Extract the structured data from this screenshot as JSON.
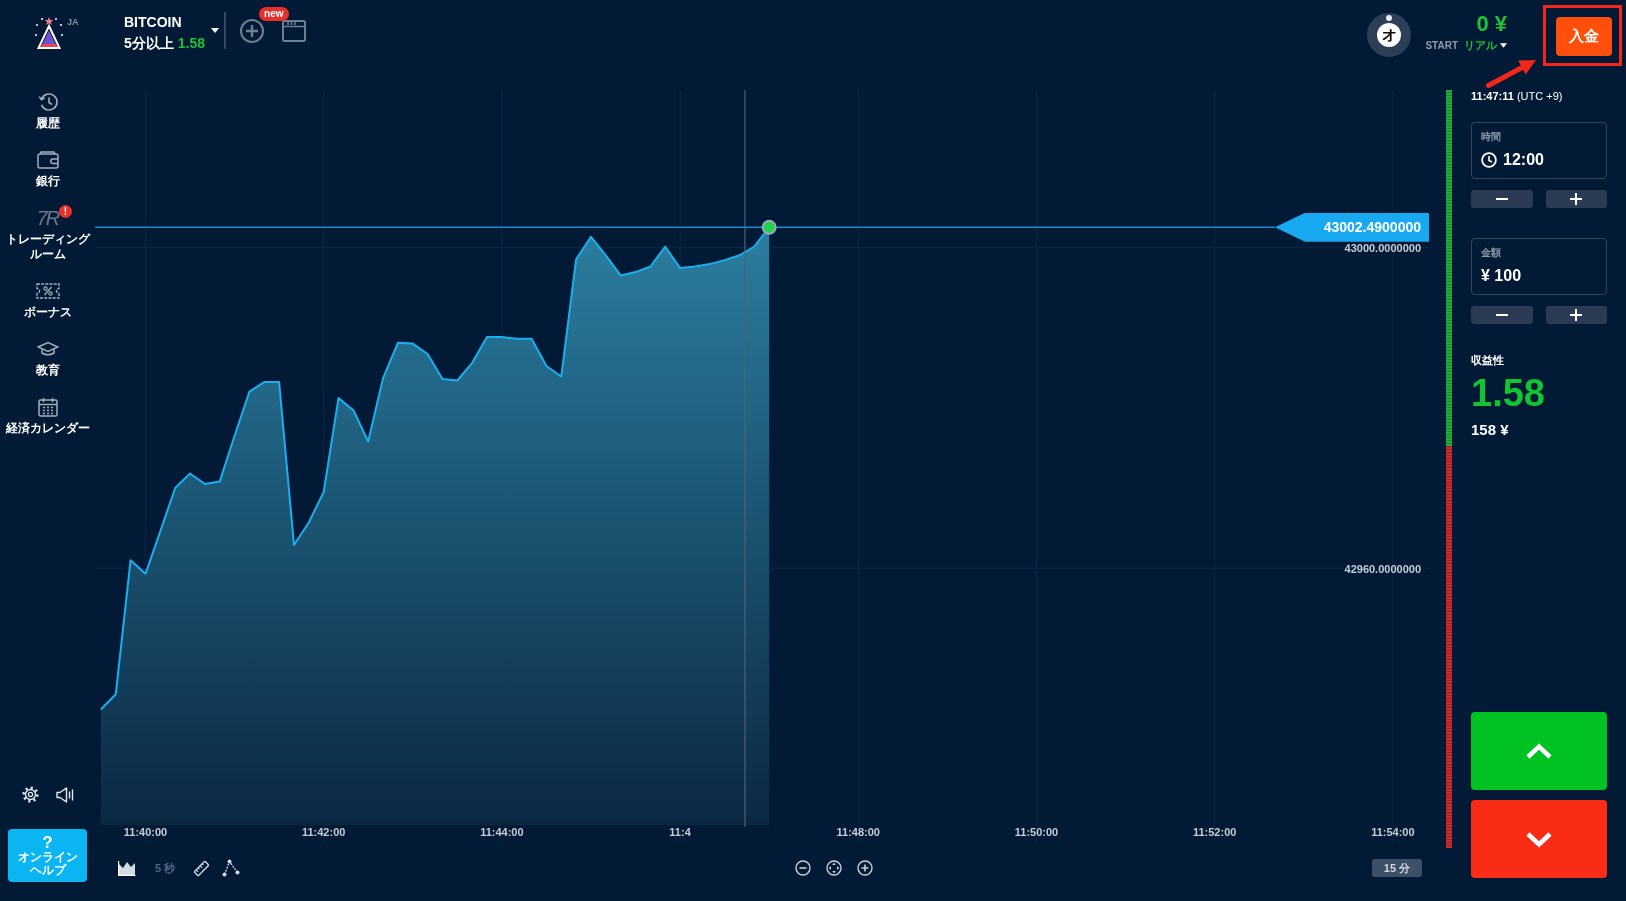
{
  "header": {
    "language": "JA",
    "asset": {
      "name": "BITCOIN",
      "condition": "5分以上",
      "payout": "1.58"
    },
    "new_badge": "new",
    "avatar": {
      "initial": "オ"
    },
    "balance": {
      "amount": "0 ¥",
      "account_type": "START",
      "mode": "リアル"
    },
    "deposit_button": {
      "label": "入金",
      "highlighted": true
    }
  },
  "sidebar": {
    "items": [
      {
        "label": "履歴",
        "selected": false
      },
      {
        "label": "銀行",
        "selected": false
      },
      {
        "label": "トレーディングルーム",
        "mark": "7R",
        "alert": "!",
        "selected": false
      },
      {
        "label": "ボーナス",
        "selected": false
      },
      {
        "label": "教育",
        "selected": false
      },
      {
        "label": "経済カレンダー",
        "selected": false
      }
    ],
    "help_button": {
      "symbol": "?",
      "label": "オンラインヘルプ"
    }
  },
  "chart": {
    "price_tag": "43002.4900000",
    "chart_data": {
      "type": "area",
      "categories": [
        null,
        null,
        null,
        "11:40:00",
        null,
        null,
        null,
        null,
        null,
        null,
        null,
        null,
        null,
        null,
        null,
        "11:42:00",
        null,
        null,
        null,
        null,
        null,
        null,
        null,
        null,
        null,
        null,
        null,
        "11:44:00",
        null,
        null,
        null,
        null,
        null,
        null,
        null,
        null,
        null,
        null,
        null,
        "11:4",
        null,
        null,
        null,
        null,
        null,
        null,
        null,
        null,
        null,
        null,
        null,
        "11:48:00",
        null,
        null,
        null,
        null,
        null,
        null,
        null,
        null,
        null,
        null,
        null,
        "11:50:00",
        null,
        null,
        null,
        null,
        null,
        null,
        null,
        null,
        null,
        null,
        null,
        "11:52:00",
        null,
        null,
        null,
        null,
        null,
        null,
        null,
        null,
        null,
        null,
        null,
        "11:54:00",
        null,
        null
      ],
      "values": [
        42942.4,
        42944.3,
        42961,
        42959.3,
        42964.6,
        42970,
        42971.8,
        42970.5,
        42970.8,
        42976.5,
        42982,
        42983.2,
        42983.2,
        42962.9,
        42965.7,
        42969.5,
        42981.2,
        42979.7,
        42975.8,
        42983.7,
        42988.1,
        42988,
        42986.7,
        42983.6,
        42983.4,
        42985.6,
        42988.8,
        42988.8,
        42988.6,
        42988.6,
        42985.2,
        42983.9,
        42998.5,
        43001.3,
        42999,
        42996.5,
        42996.9,
        42997.6,
        43000.1,
        42997.4,
        42997.6,
        42997.9,
        42998.4,
        42999,
        43000.1,
        43002.5,
        null,
        null,
        null,
        null,
        null,
        null,
        null,
        null,
        null,
        null,
        null,
        null,
        null,
        null,
        null,
        null,
        null,
        null,
        null,
        null,
        null,
        null,
        null,
        null,
        null,
        null,
        null,
        null,
        null,
        null,
        null,
        null,
        null,
        null,
        null,
        null,
        null,
        null,
        null,
        null,
        null,
        null,
        null,
        null
      ],
      "ylim": [
        42928,
        43019.6
      ],
      "yticks": [
        {
          "value": 43000,
          "label": "43000.0000000"
        },
        {
          "value": 42960,
          "label": "42960.0000000"
        }
      ],
      "grid": true,
      "ref_lines": [
        {
          "axis": "y",
          "value": 43002.5
        }
      ]
    }
  },
  "chart_toolbar": {
    "interval": {
      "label": "5 秒",
      "disabled": true
    },
    "timeframe": "15 分"
  },
  "sentiment": {
    "level": 0.47
  },
  "trade_panel": {
    "server_time": "**11:47:11** (UTC +9)",
    "time_field": {
      "label": "時間",
      "value": "12:00"
    },
    "amount_field": {
      "label": "金額",
      "value": "¥ 100"
    },
    "payout": {
      "label": "収益性",
      "rate": "1.58",
      "profit": "158 ¥"
    }
  }
}
